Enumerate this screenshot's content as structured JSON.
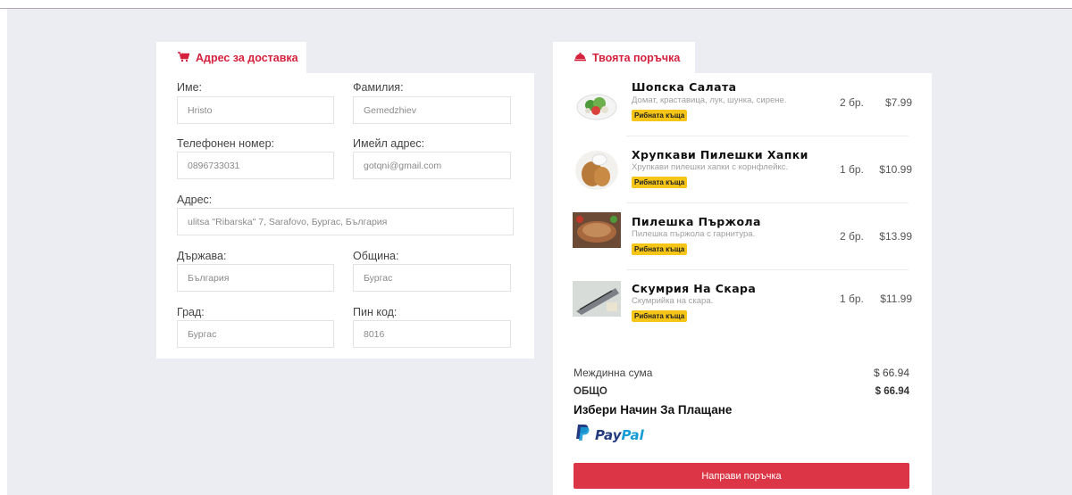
{
  "colors": {
    "accent": "#dc3545",
    "badge": "#f5c518",
    "background": "#ebedf2"
  },
  "address": {
    "tab_title": "Адрес за доставка",
    "tab_icon": "cart-icon",
    "fields": {
      "first_name": {
        "label": "Име:",
        "value": "Hristo"
      },
      "last_name": {
        "label": "Фамилия:",
        "value": "Gemedzhiev"
      },
      "phone": {
        "label": "Телефонен номер:",
        "value": "0896733031"
      },
      "email": {
        "label": "Имейл адрес:",
        "value": "gotqni@gmail.com"
      },
      "address": {
        "label": "Адрес:",
        "value": "ulitsa \"Ribarska\" 7, Sarafovo, Бургас, България"
      },
      "country": {
        "label": "Държава:",
        "value": "България"
      },
      "municipality": {
        "label": "Община:",
        "value": "Бургас"
      },
      "city": {
        "label": "Град:",
        "value": "Бургас"
      },
      "zip": {
        "label": "Пин код:",
        "value": "8016"
      }
    }
  },
  "order": {
    "tab_title": "Твоята поръчка",
    "tab_icon": "cloche-icon",
    "items": [
      {
        "name": "Шопска Салата",
        "desc": "Домат, краставица, лук, шунка, сирене.",
        "badge": "Рибната къща",
        "qty": "2 бр.",
        "price": "$7.99",
        "image": "salad-image"
      },
      {
        "name": "Хрупкави Пилешки Хапки",
        "desc": "Хрупкави пилешки хапки с корнфлейкс.",
        "badge": "Рибната къща",
        "qty": "1 бр.",
        "price": "$10.99",
        "image": "chicken-bites-image"
      },
      {
        "name": "Пилешка Пържола",
        "desc": "Пилешка пържола с гарнитура.",
        "badge": "Рибната къща",
        "qty": "2 бр.",
        "price": "$13.99",
        "image": "chicken-steak-image"
      },
      {
        "name": "Скумрия На Скара",
        "desc": "Скумрийка на скара.",
        "badge": "Рибната къща",
        "qty": "1 бр.",
        "price": "$11.99",
        "image": "grilled-mackerel-image"
      }
    ],
    "subtotal_label": "Междинна сума",
    "subtotal_value": "$ 66.94",
    "total_label": "ОБЩО",
    "total_value": "$ 66.94",
    "payment_title": "Избери Начин За Плащане",
    "payment_method": "PayPal",
    "submit_label": "Направи поръчка"
  }
}
